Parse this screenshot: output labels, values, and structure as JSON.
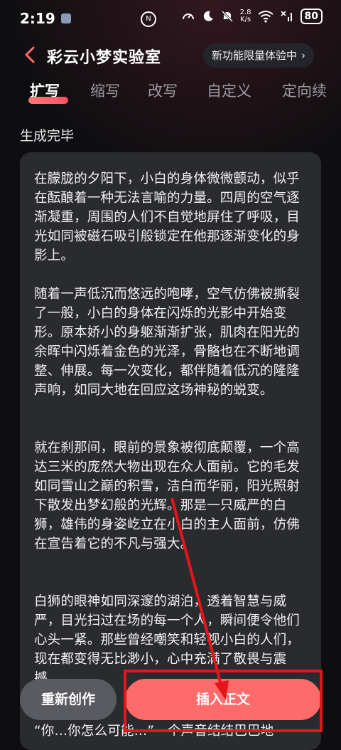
{
  "status_bar": {
    "time": "2:19",
    "nfc_label": "N",
    "speed_value": "2.8",
    "speed_unit": "K/s",
    "battery": "80"
  },
  "header": {
    "title": "彩云小梦实验室",
    "promo_label": "新功能限量体验中",
    "promo_chevron": "›"
  },
  "tabs": [
    "扩写",
    "缩写",
    "改写",
    "自定义",
    "定向续"
  ],
  "generation_status": "生成完毕",
  "content": {
    "paragraphs": [
      "在朦胧的夕阳下，小白的身体微微颤动，似乎在酝酿着一种无法言喻的力量。四周的空气逐渐凝重，周围的人们不自觉地屏住了呼吸，目光如同被磁石吸引般锁定在他那逐渐变化的身影上。",
      "随着一声低沉而悠远的咆哮，空气仿佛被撕裂了一般，小白的身体在闪烁的光影中开始变形。原本娇小的身躯渐渐扩张，肌肉在阳光的余晖中闪烁着金色的光泽，骨骼也在不断地调整、伸展。每一次变化，都伴随着低沉的隆隆声响，如同大地在回应这场神秘的蜕变。",
      "就在刹那间，眼前的景象被彻底颠覆，一个高达三米的庞然大物出现在众人面前。它的毛发如同雪山之巅的积雪，洁白而华丽，阳光照射下散发出梦幻般的光辉。那是一只威严的白狮，雄伟的身姿屹立在小白的主人面前，仿佛在宣告着它的不凡与强大。",
      "白狮的眼神如同深邃的湖泊，透着智慧与威严，目光扫过在场的每一个人，瞬间便令他们心头一紧。那些曾经嘲笑和轻视小白的人们，现在都变得无比渺小，心中充满了敬畏与震撼。",
      "“你…你怎么可能…”一个声音结结巴巴地"
    ]
  },
  "buttons": {
    "rewrite": "重新创作",
    "insert": "插入正文"
  },
  "colors": {
    "accent": "#ff6a6a",
    "annotation": "#e8141c",
    "background": "#0e0e10",
    "card": "#2a2b2f"
  }
}
